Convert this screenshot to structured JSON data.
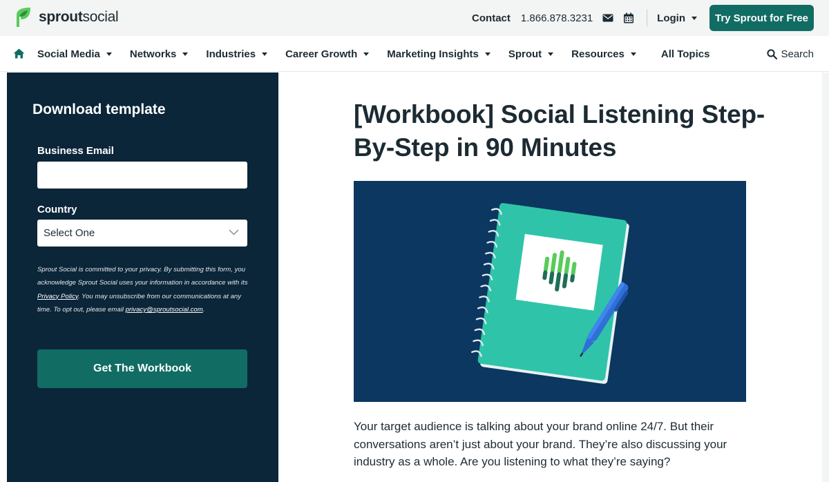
{
  "brand": {
    "logo_bold": "sprout",
    "logo_light": "social",
    "accent": "#116c63",
    "dark_panel": "#0b2539",
    "hero_bg": "#0b3760"
  },
  "topbar": {
    "contact_label": "Contact",
    "phone": "1.866.878.3231",
    "login_label": "Login",
    "cta_label": "Try Sprout for Free"
  },
  "nav": {
    "items": [
      {
        "label": "Social Media"
      },
      {
        "label": "Networks"
      },
      {
        "label": "Industries"
      },
      {
        "label": "Career Growth"
      },
      {
        "label": "Marketing Insights"
      },
      {
        "label": "Sprout"
      },
      {
        "label": "Resources"
      }
    ],
    "all_topics": "All Topics",
    "search_label": "Search"
  },
  "form": {
    "title": "Download template",
    "email_label": "Business Email",
    "email_value": "",
    "country_label": "Country",
    "country_value": "Select One",
    "privacy_part1": "Sprout Social is committed to your privacy. By submitting this form, you acknowledge Sprout Social uses your information in accordance with its ",
    "privacy_link": "Privacy Policy",
    "privacy_part2": ". You may unsubscribe from our communications at any time. To opt out, please email ",
    "privacy_email": "privacy@sproutsocial.com",
    "privacy_end": ".",
    "submit_label": "Get The Workbook"
  },
  "article": {
    "title": "[Workbook] Social Listening Step-By-Step in 90 Minutes",
    "intro": "Your target audience is talking about your brand online 24/7. But their conversations aren’t just about your brand. They’re also discussing your industry as a whole. Are you listening to what they’re saying?"
  }
}
